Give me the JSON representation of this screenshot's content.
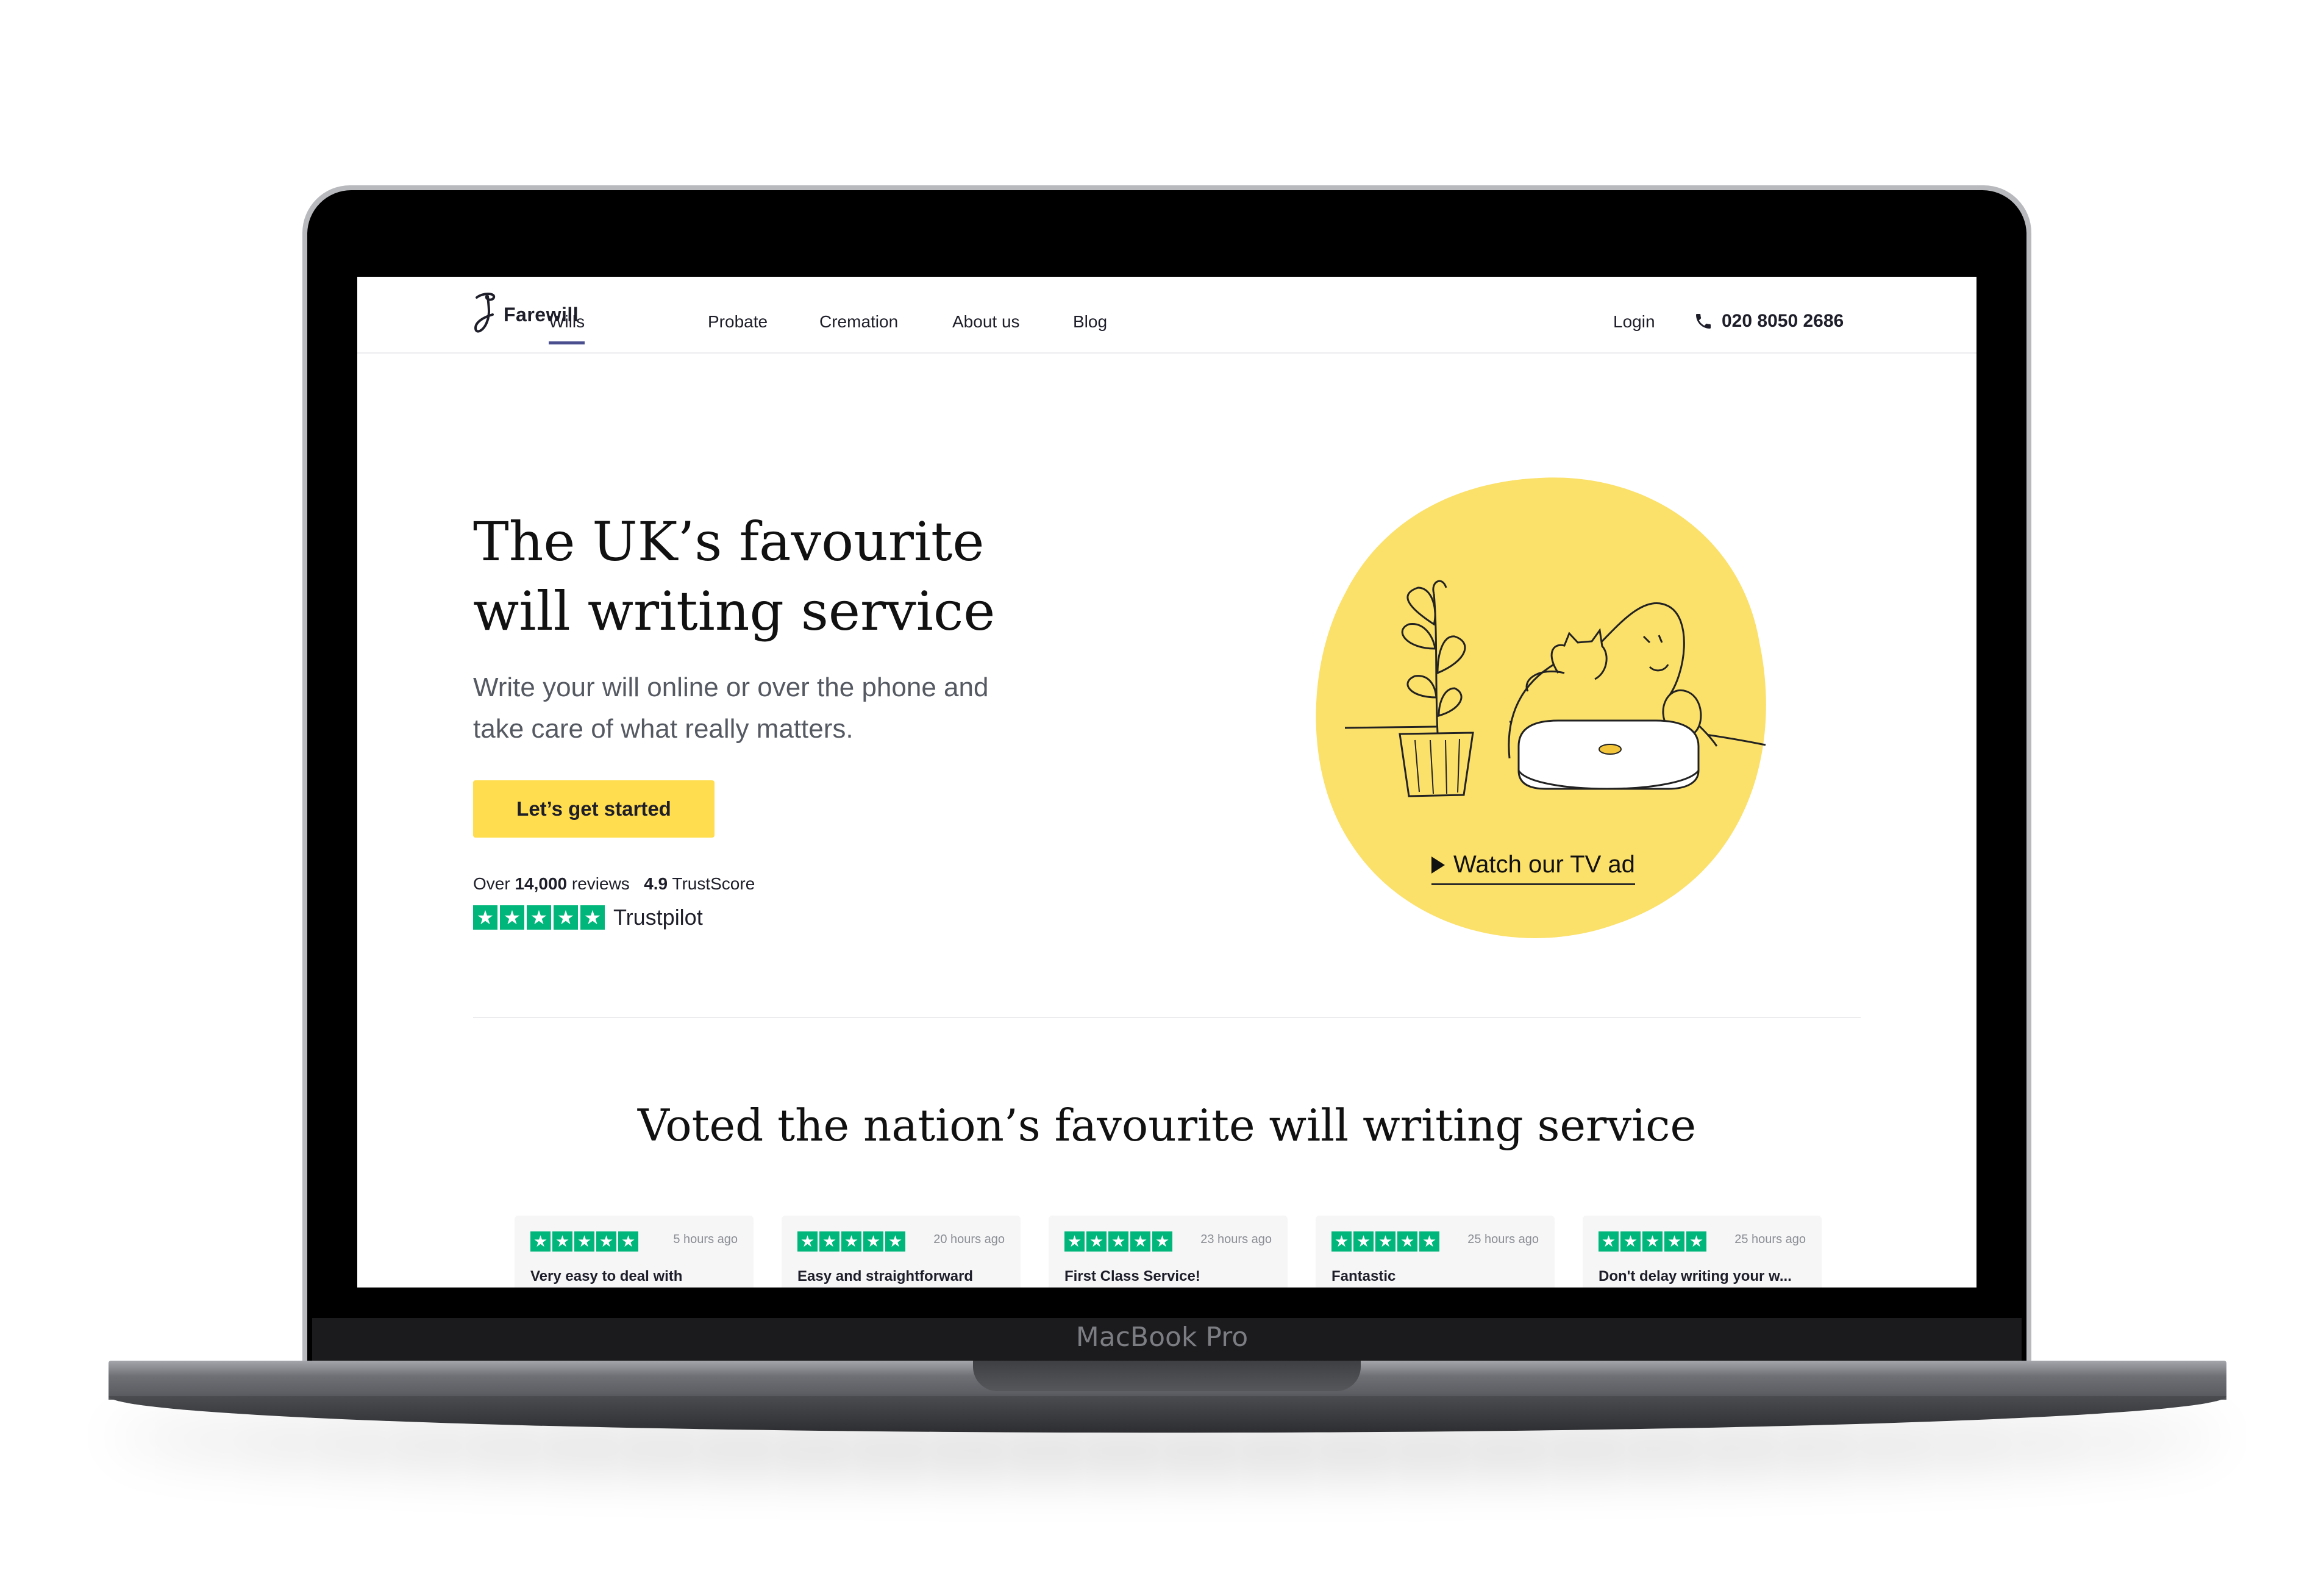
{
  "device": {
    "label": "MacBook Pro"
  },
  "brand": {
    "name": "Farewill"
  },
  "nav": {
    "items": [
      {
        "label": "Wills",
        "active": true
      },
      {
        "label": "Probate",
        "active": false
      },
      {
        "label": "Cremation",
        "active": false
      },
      {
        "label": "About us",
        "active": false
      },
      {
        "label": "Blog",
        "active": false
      }
    ],
    "login": "Login",
    "phone": "020 8050 2686",
    "phone_icon": "phone-icon"
  },
  "hero": {
    "title": "The UK’s favourite will writing service",
    "subtitle": "Write your will online or over the phone and take care of what really matters.",
    "cta": "Let’s get started",
    "reviews_prefix": "Over",
    "reviews_count": "14,000",
    "reviews_word": "reviews",
    "trustscore_value": "4.9",
    "trustscore_label": "TrustScore",
    "trustpilot": "Trustpilot",
    "watch_label": "Watch our TV ad"
  },
  "section": {
    "title": "Voted the nation’s favourite will writing service"
  },
  "reviews": [
    {
      "time": "5 hours ago",
      "title": "Very easy to deal with",
      "stars": 5
    },
    {
      "time": "20 hours ago",
      "title": "Easy and straightforward",
      "stars": 5
    },
    {
      "time": "23 hours ago",
      "title": "First Class Service!",
      "stars": 5
    },
    {
      "time": "25 hours ago",
      "title": "Fantastic",
      "stars": 5
    },
    {
      "time": "25 hours ago",
      "title": "Don't delay writing your w...",
      "stars": 5
    }
  ],
  "colors": {
    "accent": "#ffdd4e",
    "nav_underline": "#4a4e8f",
    "trustpilot_green": "#00b67a",
    "illustration_yellow": "#fbe06a"
  }
}
